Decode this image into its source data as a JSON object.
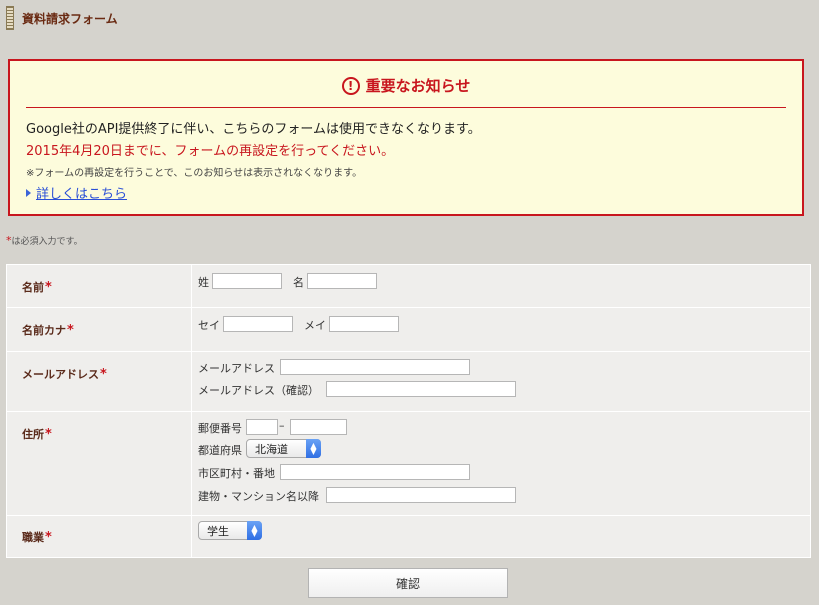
{
  "header": {
    "title": "資料請求フォーム"
  },
  "notice": {
    "title": "重要なお知らせ",
    "line1": "Google社のAPI提供終了に伴い、こちらのフォームは使用できなくなります。",
    "line2": "2015年4月20日までに、フォームの再設定を行ってください。",
    "line3": "※フォームの再設定を行うことで、このお知らせは表示されなくなります。",
    "link": "詳しくはこちら",
    "accent_color": "#c8161e"
  },
  "required_note": {
    "star": "*",
    "text": "は必須入力です。"
  },
  "form": {
    "rows": [
      {
        "label": "名前",
        "required": "*",
        "fields": {
          "last": "姓",
          "first": "名"
        }
      },
      {
        "label": "名前カナ",
        "required": "*",
        "fields": {
          "last": "セイ",
          "first": "メイ"
        }
      },
      {
        "label": "メールアドレス",
        "required": "*",
        "fields": {
          "email": "メールアドレス",
          "email_confirm": "メールアドレス（確認）"
        }
      },
      {
        "label": "住所",
        "required": "*",
        "fields": {
          "postal": "郵便番号",
          "postal_dash": "–",
          "prefecture": "都道府県",
          "prefecture_value": "北海道",
          "city": "市区町村・番地",
          "building": "建物・マンション名以降"
        }
      },
      {
        "label": "職業",
        "required": "*",
        "fields": {
          "occupation_value": "学生"
        }
      }
    ]
  },
  "submit": {
    "label": "確認"
  }
}
